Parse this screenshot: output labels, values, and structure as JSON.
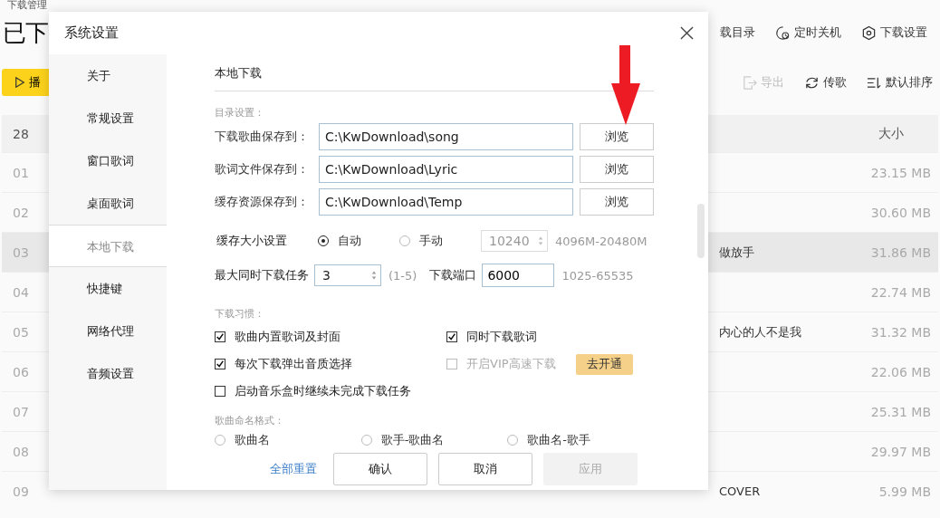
{
  "app": {
    "title": "下载管理",
    "heading": "已下",
    "toolbar_top": [
      {
        "kind": "folder",
        "label": "载目录"
      },
      {
        "kind": "timer",
        "label": "定时关机"
      },
      {
        "kind": "gear",
        "label": "下载设置"
      }
    ],
    "play_button": "播",
    "toolbar": [
      {
        "kind": "export",
        "label": "导出",
        "disabled": true
      },
      {
        "kind": "sync",
        "label": "传歌",
        "disabled": false
      },
      {
        "kind": "sort",
        "label": "默认排序",
        "disabled": false
      }
    ],
    "table": {
      "count": "28",
      "size_header": "大小",
      "rows": [
        {
          "num": "01",
          "size": "23.15 MB",
          "selected": false
        },
        {
          "num": "02",
          "size": "30.60 MB",
          "selected": false
        },
        {
          "num": "03",
          "album": "做放手",
          "size": "31.86 MB",
          "selected": true
        },
        {
          "num": "04",
          "size": "22.74 MB",
          "selected": false
        },
        {
          "num": "05",
          "album": "内心的人不是我",
          "size": "31.32 MB",
          "selected": false
        },
        {
          "num": "06",
          "size": "22.06 MB",
          "selected": false
        },
        {
          "num": "07",
          "size": "25.31 MB",
          "selected": false
        },
        {
          "num": "08",
          "size": "29.97 MB",
          "selected": false
        },
        {
          "num": "09",
          "album": "COVER",
          "size": "5.99 MB",
          "selected": false
        }
      ]
    }
  },
  "dialog": {
    "title": "系统设置",
    "nav": [
      {
        "label": "关于",
        "selected": false
      },
      {
        "label": "常规设置",
        "selected": false
      },
      {
        "label": "窗口歌词",
        "selected": false
      },
      {
        "label": "桌面歌词",
        "selected": false
      },
      {
        "label": "本地下载",
        "selected": true
      },
      {
        "label": "快捷键",
        "selected": false
      },
      {
        "label": "网络代理",
        "selected": false
      },
      {
        "label": "音频设置",
        "selected": false
      }
    ],
    "section_title": "本地下载",
    "dir_group": "目录设置：",
    "paths": [
      {
        "label": "下载歌曲保存到：",
        "value": "C:\\KwDownload\\song",
        "button": "浏览"
      },
      {
        "label": "歌词文件保存到：",
        "value": "C:\\KwDownload\\Lyric",
        "button": "浏览"
      },
      {
        "label": "缓存资源保存到：",
        "value": "C:\\KwDownload\\Temp",
        "button": "浏览"
      }
    ],
    "cache": {
      "label": "缓存大小设置",
      "options": [
        {
          "label": "自动",
          "selected": true
        },
        {
          "label": "手动",
          "selected": false
        }
      ],
      "size_value": "10240",
      "size_range": "4096M-20480M"
    },
    "max_tasks": {
      "label": "最大同时下载任务",
      "value": "3",
      "range": "(1-5)"
    },
    "port": {
      "label": "下载端口",
      "value": "6000",
      "range": "1025-65535"
    },
    "habits_group": "下载习惯：",
    "habits": [
      {
        "label": "歌曲内置歌词及封面",
        "checked": true,
        "disabled": false
      },
      {
        "label": "同时下载歌词",
        "checked": true,
        "disabled": false
      },
      {
        "label": "每次下载弹出音质选择",
        "checked": true,
        "disabled": false
      },
      {
        "label": "开启VIP高速下载",
        "checked": false,
        "disabled": true,
        "action": "去开通"
      },
      {
        "label": "启动音乐盒时继续未完成下载任务",
        "checked": false,
        "disabled": false
      }
    ],
    "naming_group": "歌曲命名格式：",
    "naming": [
      {
        "label": "歌曲名",
        "selected": false
      },
      {
        "label": "歌手-歌曲名",
        "selected": false
      },
      {
        "label": "歌曲名-歌手",
        "selected": false
      }
    ],
    "footer": {
      "reset": "全部重置",
      "ok": "确认",
      "cancel": "取消",
      "apply": "应用",
      "apply_disabled": true
    }
  }
}
